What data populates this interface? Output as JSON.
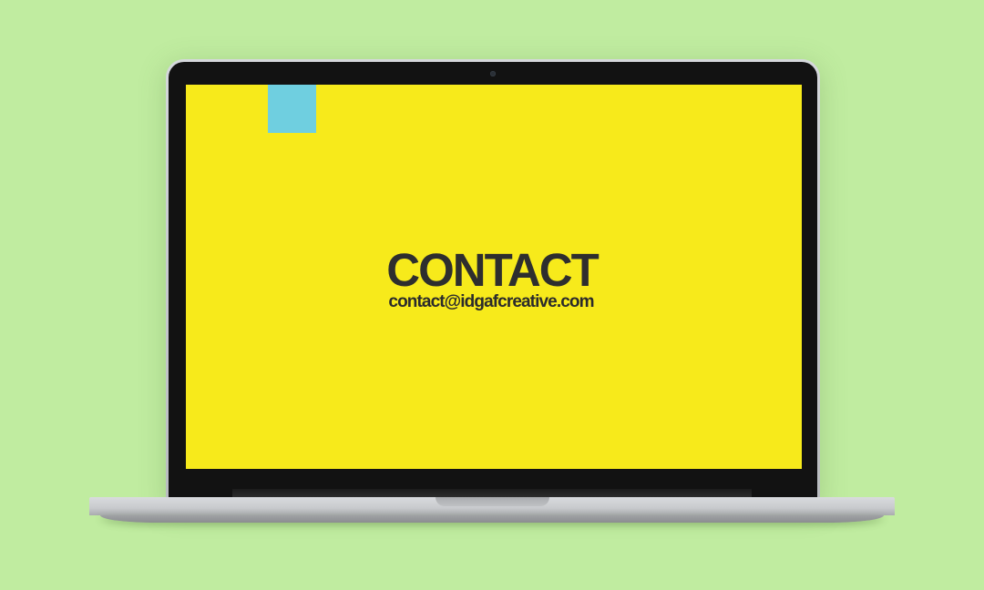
{
  "screen": {
    "background_color": "#f7ea1b",
    "accent_color": "#6fcfe0"
  },
  "contact": {
    "title": "CONTACT",
    "email": "contact@idgafcreative.com"
  },
  "page": {
    "background_color": "#c0eca0"
  }
}
